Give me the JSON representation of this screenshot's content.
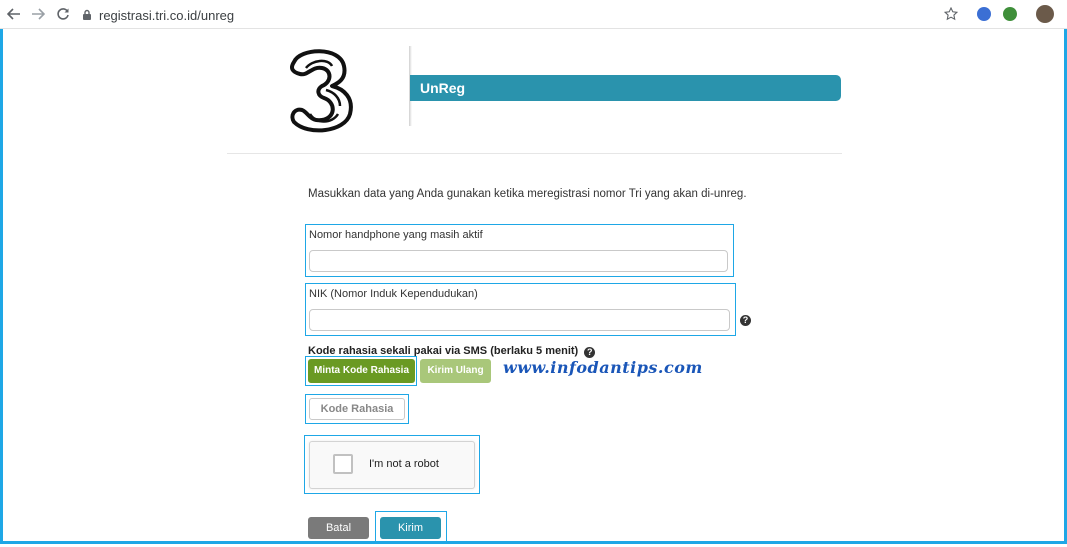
{
  "browser": {
    "url": "registrasi.tri.co.id/unreg",
    "back_icon": "arrow-left-icon",
    "forward_icon": "arrow-right-icon",
    "reload_icon": "reload-icon",
    "lock_icon": "lock-icon",
    "star_icon": "star-icon"
  },
  "header": {
    "logo_text": "3",
    "section_title": "UnReg",
    "accent_color": "#2a93ad"
  },
  "form": {
    "intro": "Masukkan data yang Anda gunakan ketika meregistrasi nomor Tri yang akan di-unreg.",
    "phone_label": "Nomor handphone yang masih aktif",
    "phone_value": "",
    "nik_label": "NIK (Nomor Induk Kependudukan)",
    "nik_value": "",
    "help_glyph": "?",
    "sms_label": "Kode rahasia sekali pakai via SMS (berlaku 5 menit)",
    "request_code_button": "Minta Kode Rahasia",
    "resend_button": "Kirim Ulang",
    "code_placeholder": "Kode Rahasia",
    "captcha_text": "I'm not a robot",
    "cancel_button": "Batal",
    "submit_button": "Kirim"
  },
  "watermark": "www.infodantips.com",
  "colors": {
    "highlight": "#1ea7e6",
    "green_button": "#6a9a23",
    "green_light_button": "#a9c77a",
    "gray_button": "#7a7a7a",
    "submit_button": "#2a93ad"
  }
}
